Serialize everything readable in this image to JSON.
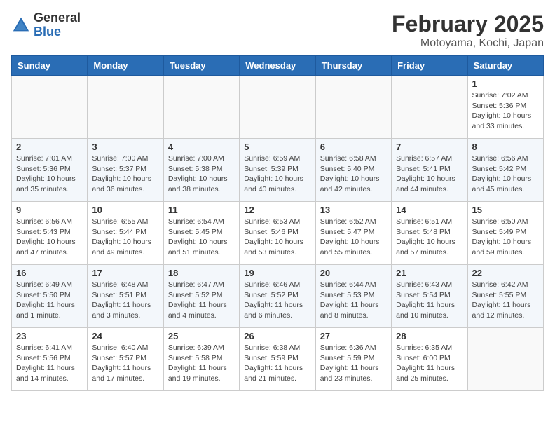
{
  "header": {
    "logo_general": "General",
    "logo_blue": "Blue",
    "main_title": "February 2025",
    "subtitle": "Motoyama, Kochi, Japan"
  },
  "weekdays": [
    "Sunday",
    "Monday",
    "Tuesday",
    "Wednesday",
    "Thursday",
    "Friday",
    "Saturday"
  ],
  "weeks": [
    [
      {
        "day": "",
        "info": ""
      },
      {
        "day": "",
        "info": ""
      },
      {
        "day": "",
        "info": ""
      },
      {
        "day": "",
        "info": ""
      },
      {
        "day": "",
        "info": ""
      },
      {
        "day": "",
        "info": ""
      },
      {
        "day": "1",
        "info": "Sunrise: 7:02 AM\nSunset: 5:36 PM\nDaylight: 10 hours\nand 33 minutes."
      }
    ],
    [
      {
        "day": "2",
        "info": "Sunrise: 7:01 AM\nSunset: 5:36 PM\nDaylight: 10 hours\nand 35 minutes."
      },
      {
        "day": "3",
        "info": "Sunrise: 7:00 AM\nSunset: 5:37 PM\nDaylight: 10 hours\nand 36 minutes."
      },
      {
        "day": "4",
        "info": "Sunrise: 7:00 AM\nSunset: 5:38 PM\nDaylight: 10 hours\nand 38 minutes."
      },
      {
        "day": "5",
        "info": "Sunrise: 6:59 AM\nSunset: 5:39 PM\nDaylight: 10 hours\nand 40 minutes."
      },
      {
        "day": "6",
        "info": "Sunrise: 6:58 AM\nSunset: 5:40 PM\nDaylight: 10 hours\nand 42 minutes."
      },
      {
        "day": "7",
        "info": "Sunrise: 6:57 AM\nSunset: 5:41 PM\nDaylight: 10 hours\nand 44 minutes."
      },
      {
        "day": "8",
        "info": "Sunrise: 6:56 AM\nSunset: 5:42 PM\nDaylight: 10 hours\nand 45 minutes."
      }
    ],
    [
      {
        "day": "9",
        "info": "Sunrise: 6:56 AM\nSunset: 5:43 PM\nDaylight: 10 hours\nand 47 minutes."
      },
      {
        "day": "10",
        "info": "Sunrise: 6:55 AM\nSunset: 5:44 PM\nDaylight: 10 hours\nand 49 minutes."
      },
      {
        "day": "11",
        "info": "Sunrise: 6:54 AM\nSunset: 5:45 PM\nDaylight: 10 hours\nand 51 minutes."
      },
      {
        "day": "12",
        "info": "Sunrise: 6:53 AM\nSunset: 5:46 PM\nDaylight: 10 hours\nand 53 minutes."
      },
      {
        "day": "13",
        "info": "Sunrise: 6:52 AM\nSunset: 5:47 PM\nDaylight: 10 hours\nand 55 minutes."
      },
      {
        "day": "14",
        "info": "Sunrise: 6:51 AM\nSunset: 5:48 PM\nDaylight: 10 hours\nand 57 minutes."
      },
      {
        "day": "15",
        "info": "Sunrise: 6:50 AM\nSunset: 5:49 PM\nDaylight: 10 hours\nand 59 minutes."
      }
    ],
    [
      {
        "day": "16",
        "info": "Sunrise: 6:49 AM\nSunset: 5:50 PM\nDaylight: 11 hours\nand 1 minute."
      },
      {
        "day": "17",
        "info": "Sunrise: 6:48 AM\nSunset: 5:51 PM\nDaylight: 11 hours\nand 3 minutes."
      },
      {
        "day": "18",
        "info": "Sunrise: 6:47 AM\nSunset: 5:52 PM\nDaylight: 11 hours\nand 4 minutes."
      },
      {
        "day": "19",
        "info": "Sunrise: 6:46 AM\nSunset: 5:52 PM\nDaylight: 11 hours\nand 6 minutes."
      },
      {
        "day": "20",
        "info": "Sunrise: 6:44 AM\nSunset: 5:53 PM\nDaylight: 11 hours\nand 8 minutes."
      },
      {
        "day": "21",
        "info": "Sunrise: 6:43 AM\nSunset: 5:54 PM\nDaylight: 11 hours\nand 10 minutes."
      },
      {
        "day": "22",
        "info": "Sunrise: 6:42 AM\nSunset: 5:55 PM\nDaylight: 11 hours\nand 12 minutes."
      }
    ],
    [
      {
        "day": "23",
        "info": "Sunrise: 6:41 AM\nSunset: 5:56 PM\nDaylight: 11 hours\nand 14 minutes."
      },
      {
        "day": "24",
        "info": "Sunrise: 6:40 AM\nSunset: 5:57 PM\nDaylight: 11 hours\nand 17 minutes."
      },
      {
        "day": "25",
        "info": "Sunrise: 6:39 AM\nSunset: 5:58 PM\nDaylight: 11 hours\nand 19 minutes."
      },
      {
        "day": "26",
        "info": "Sunrise: 6:38 AM\nSunset: 5:59 PM\nDaylight: 11 hours\nand 21 minutes."
      },
      {
        "day": "27",
        "info": "Sunrise: 6:36 AM\nSunset: 5:59 PM\nDaylight: 11 hours\nand 23 minutes."
      },
      {
        "day": "28",
        "info": "Sunrise: 6:35 AM\nSunset: 6:00 PM\nDaylight: 11 hours\nand 25 minutes."
      },
      {
        "day": "",
        "info": ""
      }
    ]
  ]
}
